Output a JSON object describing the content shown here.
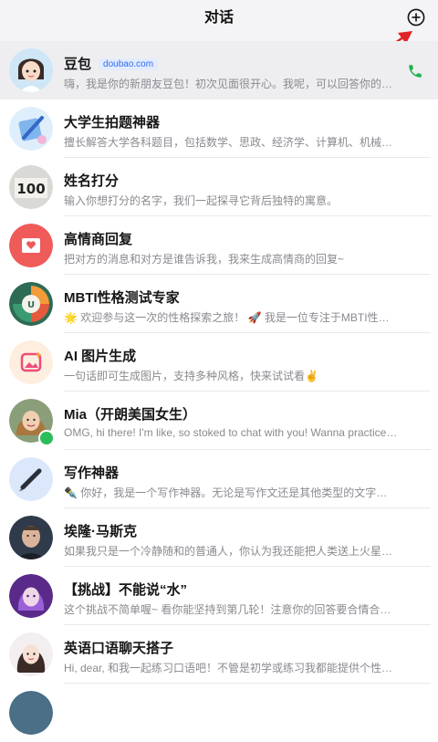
{
  "header": {
    "title": "对话"
  },
  "conversations": [
    {
      "name": "豆包",
      "badge": "doubao.com",
      "preview": "嗨，我是你的新朋友豆包！初次见面很开心。我呢，可以回答你的各种..."
    },
    {
      "name": "大学生拍题神器",
      "preview": "擅长解答大学各科题目，包括数学、思政、经济学、计算机、机械、法..."
    },
    {
      "name": "姓名打分",
      "preview": "输入你想打分的名字，我们一起探寻它背后独特的寓意。"
    },
    {
      "name": "高情商回复",
      "preview": "把对方的消息和对方是谁告诉我，我来生成高情商的回复~"
    },
    {
      "name": "MBTI性格测试专家",
      "preview": "🌟 欢迎参与这一次的性格探索之旅！ 🚀 我是一位专注于MBTI性格类型..."
    },
    {
      "name": "AI 图片生成",
      "preview": "一句话即可生成图片，支持多种风格，快来试试看✌️"
    },
    {
      "name": "Mia（开朗美国女生）",
      "preview": "OMG, hi there! I'm like, so stoked to chat with you! Wanna practice some..."
    },
    {
      "name": "写作神器",
      "preview": "✒️ 你好，我是一个写作神器。无论是写作文还是其他类型的文字创作，..."
    },
    {
      "name": "埃隆·马斯克",
      "preview": "如果我只是一个冷静随和的普通人，你认为我还能把人类送上火星么？"
    },
    {
      "name": "【挑战】不能说“水”",
      "preview": "这个挑战不简单喔~ 看你能坚持到第几轮！注意你的回答要合情合理喔~..."
    },
    {
      "name": "英语口语聊天搭子",
      "preview": "Hi, dear, 和我一起练习口语吧！不管是初学或练习我都能提供个性化的学..."
    }
  ]
}
